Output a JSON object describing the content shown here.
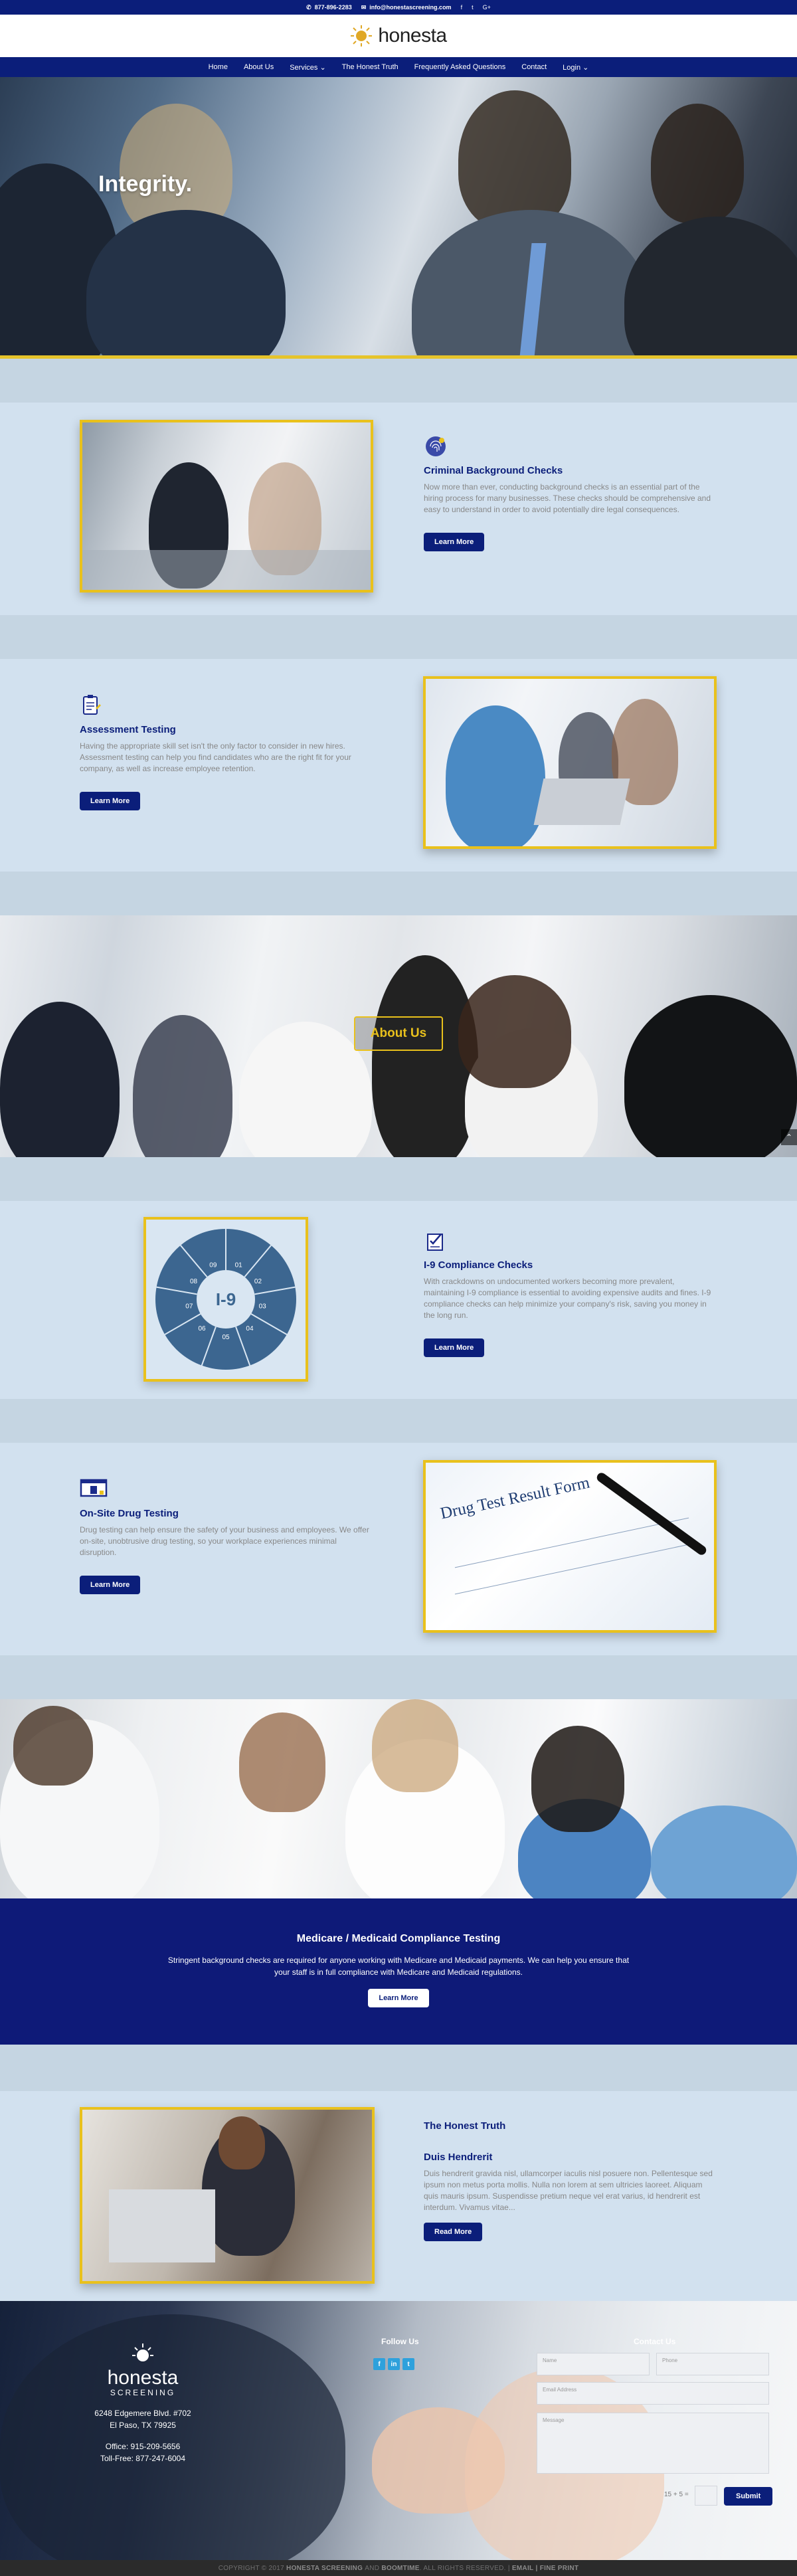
{
  "topbar": {
    "phone": "877-896-2283",
    "email": "info@honestascreening.com",
    "social": [
      "f",
      "t",
      "G+"
    ]
  },
  "header": {
    "logo_text": "honesta"
  },
  "nav": {
    "items": [
      "Home",
      "About Us",
      "Services",
      "The Honest Truth",
      "Frequently Asked Questions",
      "Contact",
      "Login"
    ]
  },
  "hero": {
    "title": "Integrity."
  },
  "features": [
    {
      "title": "Criminal Background Checks",
      "desc": "Now more than ever, conducting background checks is an essential part of the hiring process for many businesses. These checks should be comprehensive and easy to understand in order to avoid potentially dire legal consequences.",
      "button": "Learn More",
      "icon": "fingerprint-icon"
    },
    {
      "title": "Assessment Testing",
      "desc": "Having the appropriate skill set isn't the only factor to consider in new hires. Assessment testing can help you find candidates who are the right fit for your company, as well as increase employee retention.",
      "button": "Learn More",
      "icon": "clipboard-icon"
    },
    {
      "title": "I-9 Compliance Checks",
      "desc": "With crackdowns on undocumented workers becoming more prevalent, maintaining I-9 compliance is essential to avoiding expensive audits and fines. I-9 compliance checks can help minimize your company's risk, saving you money in the long run.",
      "button": "Learn More",
      "icon": "checklist-icon"
    },
    {
      "title": "On-Site Drug Testing",
      "desc": "Drug testing can help ensure the safety of your business and employees. We offer on-site, unobtrusive drug testing, so your workplace experiences minimal disruption.",
      "button": "Learn More",
      "icon": "laptop-icon"
    }
  ],
  "i9_graphic": {
    "center": "I-9",
    "segments": [
      "01",
      "02",
      "03",
      "04",
      "05",
      "06",
      "07",
      "08",
      "09"
    ]
  },
  "drug_doc": {
    "title": "Drug Test Result Form"
  },
  "about": {
    "button": "About Us"
  },
  "medicare": {
    "title": "Medicare / Medicaid Compliance Testing",
    "text": "Stringent background checks are required for anyone working with Medicare and Medicaid payments. We can help you ensure that your staff is in full compliance with Medicare and Medicaid regulations.",
    "button": "Learn More"
  },
  "blog": {
    "section_title": "The Honest Truth",
    "post_title": "Duis Hendrerit",
    "excerpt": "Duis hendrerit gravida nisl, ullamcorper iaculis nisl posuere non. Pellentesque sed ipsum non metus porta mollis. Nulla non lorem at sem ultricies laoreet. Aliquam quis mauris ipsum. Suspendisse pretium neque vel erat varius, id hendrerit est interdum. Vivamus vitae...",
    "button": "Read More"
  },
  "footer": {
    "logo_text": "honesta",
    "logo_sub": "SCREENING",
    "address1": "6248 Edgemere Blvd. #702",
    "address2": "El Paso, TX 79925",
    "office": "Office: 915-209-5656",
    "tollfree": "Toll-Free: 877-247-6004",
    "follow_title": "Follow Us",
    "social": [
      "f",
      "in",
      "t"
    ],
    "contact_title": "Contact Us",
    "name_placeholder": "Name",
    "phone_placeholder": "Phone",
    "email_placeholder": "Email Address",
    "message_placeholder": "Message",
    "captcha": "15 + 5 =",
    "submit": "Submit"
  },
  "copyright": {
    "prefix": "COPYRIGHT © 2017",
    "company": "HONESTA SCREENING",
    "and": "AND",
    "boomtime": "BOOMTIME",
    "rights": ". ALL RIGHTS RESERVED. |",
    "email": "EMAIL",
    "sep": "|",
    "fine": "FINE PRINT"
  },
  "colors": {
    "navy": "#0b1e7a",
    "gold": "#e9c11c",
    "band": "#c5d5e2",
    "section": "#d2e1ef"
  }
}
